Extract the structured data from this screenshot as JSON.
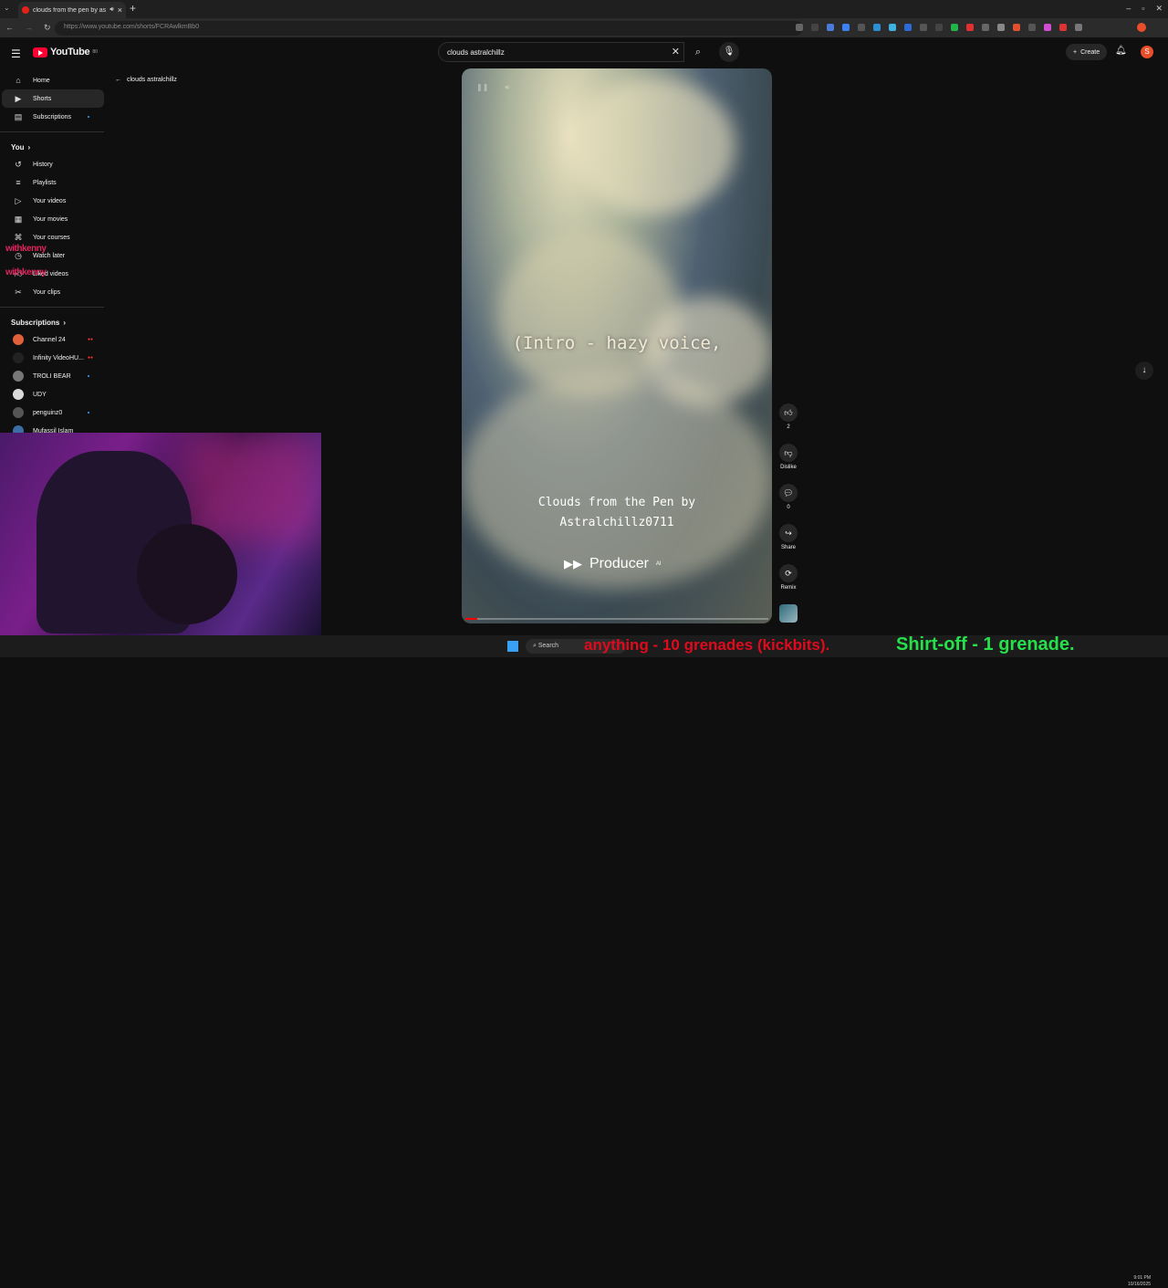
{
  "browser": {
    "tab_title": "clouds from the pen by astr",
    "url": "https://www.youtube.com/shorts/FCRAwlkmBb0"
  },
  "header": {
    "logo_text": "YouTube",
    "logo_sup": "80",
    "search_value": "clouds astralchillz",
    "create_label": "Create",
    "avatar_letter": "S"
  },
  "sidebar": {
    "main": [
      {
        "label": "Home",
        "icon": "home-icon"
      },
      {
        "label": "Shorts",
        "icon": "shorts-icon"
      },
      {
        "label": "Subscriptions",
        "icon": "subscriptions-icon"
      }
    ],
    "you_heading": "You",
    "you_items": [
      {
        "label": "History"
      },
      {
        "label": "Playlists"
      },
      {
        "label": "Your videos"
      },
      {
        "label": "Your movies"
      },
      {
        "label": "Your courses"
      },
      {
        "label": "Watch later"
      },
      {
        "label": "Liked videos"
      },
      {
        "label": "Your clips"
      }
    ],
    "subs_heading": "Subscriptions",
    "subs": [
      {
        "label": "Channel 24",
        "color": "#e0603a"
      },
      {
        "label": "Infinity VideoHU...",
        "color": "#222222"
      },
      {
        "label": "TROLI BEAR",
        "color": "#777777"
      },
      {
        "label": "UDY",
        "color": "#d9d9d9"
      },
      {
        "label": "penguinz0",
        "color": "#555555"
      },
      {
        "label": "Mufassil Islam",
        "color": "#3a6ea5"
      }
    ]
  },
  "short": {
    "back_label": "clouds astralchillz",
    "lyric": "(Intro - hazy voice,",
    "caption_line1": "Clouds from the Pen by",
    "caption_line2": "Astralchillz0711",
    "producer": "Producer",
    "producer_sup": "AI",
    "progress": 0.04
  },
  "actions": {
    "like_count": "2",
    "dislike_label": "Dislike",
    "comment_count": "0",
    "share_label": "Share",
    "remix_label": "Remix"
  },
  "overlay": {
    "tag1": "withkenny",
    "tag2": "withkenny"
  },
  "taskbar": {
    "search_label": "Search",
    "ticker_red": "anything - 10 grenades (kickbits).",
    "ticker_green": "Shirt-off -   1 grenade.",
    "time": "9:01 PM",
    "date": "10/16/2025"
  }
}
